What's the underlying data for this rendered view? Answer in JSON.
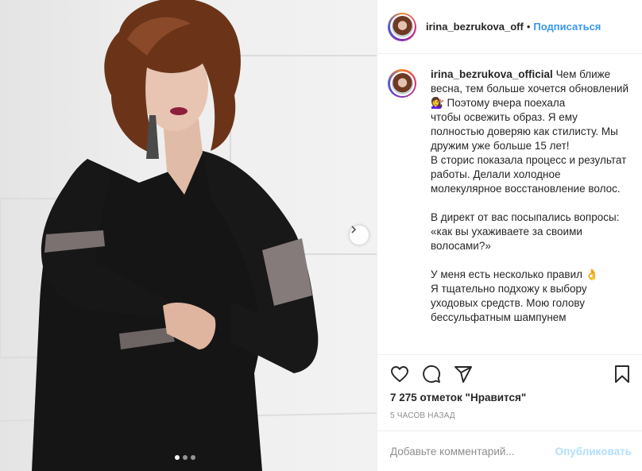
{
  "post": {
    "header": {
      "username": "irina_bezrukova_off",
      "separator": "•",
      "follow_label": "Подписаться"
    },
    "caption": {
      "username": "irina_bezrukova_official",
      "text": " Чем ближе весна, тем больше хочется обновлений 💇‍♀️ Поэтому вчера поехала                           чтобы освежить образ. Я ему полностью доверяю как стилисту. Мы дружим уже больше 15 лет!\nВ сторис показала процесс и результат работы. Делали холодное молекулярное восстановление волос.\n\nВ директ от вас посыпались вопросы: «как вы ухаживаете за своими волосами?»\n\nУ меня есть несколько правил 👌\nЯ тщательно подхожу к выбору уходовых средств. Мою голову бессульфатным шампунем"
    },
    "likes_text": "7 275 отметок \"Нравится\"",
    "timestamp": "5 ЧАСОВ НАЗАД",
    "comment": {
      "placeholder": "Добавьте комментарий...",
      "publish_label": "Опубликовать"
    },
    "carousel": {
      "slide_count": 3,
      "active_index": 0
    },
    "icons": {
      "like": "heart-icon",
      "comment": "comment-icon",
      "share": "share-icon",
      "save": "bookmark-icon",
      "next": "chevron-right-icon"
    },
    "colors": {
      "link": "#3897f0",
      "publish_disabled": "#b2dffc",
      "muted": "#8e8e8e"
    }
  }
}
